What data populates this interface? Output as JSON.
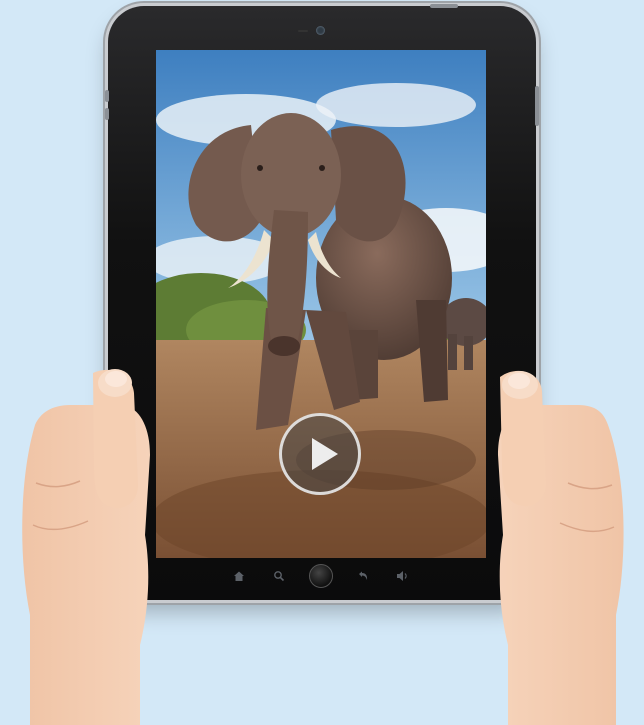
{
  "scene": {
    "background_color": "#d3e8f7",
    "device": "tablet",
    "device_color": "#111111",
    "screen_content": "video-frame-elephant"
  },
  "video_player": {
    "play_icon": "play-icon"
  },
  "nav_bar": {
    "items": [
      "home-icon",
      "search-icon",
      "home-button",
      "back-icon",
      "volume-icon"
    ]
  }
}
